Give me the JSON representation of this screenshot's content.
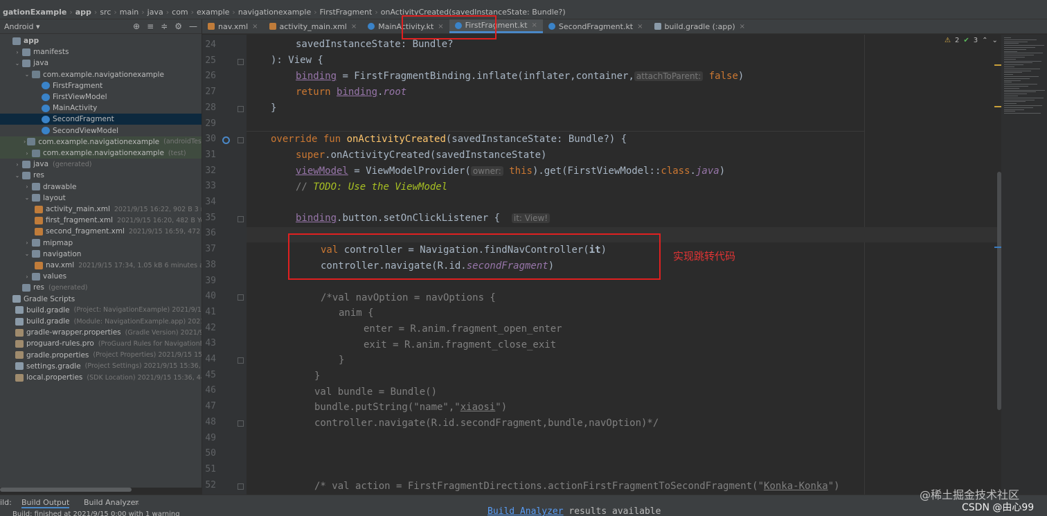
{
  "breadcrumb": [
    "gationExample",
    "app",
    "src",
    "main",
    "java",
    "com",
    "example",
    "navigationexample",
    "FirstFragment",
    "onActivityCreated(savedInstanceState: Bundle?)"
  ],
  "project": {
    "view": "Android",
    "tools": [
      "target-icon",
      "expand-icon",
      "collapse-icon",
      "gear-icon",
      "minimize-icon"
    ]
  },
  "tree": [
    {
      "depth": 0,
      "arrow": "",
      "icon": "folder",
      "label": "app",
      "meta": "",
      "bold": true
    },
    {
      "depth": 1,
      "arrow": "›",
      "icon": "folder",
      "label": "manifests",
      "meta": ""
    },
    {
      "depth": 1,
      "arrow": "⌄",
      "icon": "folder",
      "label": "java",
      "meta": ""
    },
    {
      "depth": 2,
      "arrow": "⌄",
      "icon": "pkg",
      "label": "com.example.navigationexample",
      "meta": ""
    },
    {
      "depth": 3,
      "arrow": "",
      "icon": "kt",
      "label": "FirstFragment",
      "meta": ""
    },
    {
      "depth": 3,
      "arrow": "",
      "icon": "kt",
      "label": "FirstViewModel",
      "meta": ""
    },
    {
      "depth": 3,
      "arrow": "",
      "icon": "kt",
      "label": "MainActivity",
      "meta": ""
    },
    {
      "depth": 3,
      "arrow": "",
      "icon": "kt",
      "label": "SecondFragment",
      "meta": "",
      "selected": true
    },
    {
      "depth": 3,
      "arrow": "",
      "icon": "kt",
      "label": "SecondViewModel",
      "meta": ""
    },
    {
      "depth": 2,
      "arrow": "›",
      "icon": "pkg",
      "label": "com.example.navigationexample",
      "meta": "(androidTest)",
      "test": true
    },
    {
      "depth": 2,
      "arrow": "›",
      "icon": "pkg",
      "label": "com.example.navigationexample",
      "meta": "(test)",
      "test": true
    },
    {
      "depth": 1,
      "arrow": "›",
      "icon": "folder",
      "label": "java",
      "meta": "(generated)"
    },
    {
      "depth": 1,
      "arrow": "⌄",
      "icon": "folder",
      "label": "res",
      "meta": ""
    },
    {
      "depth": 2,
      "arrow": "›",
      "icon": "folder",
      "label": "drawable",
      "meta": ""
    },
    {
      "depth": 2,
      "arrow": "⌄",
      "icon": "folder",
      "label": "layout",
      "meta": ""
    },
    {
      "depth": 3,
      "arrow": "",
      "icon": "xml",
      "label": "activity_main.xml",
      "meta": "2021/9/15 16:22, 902 B 3 minutes a"
    },
    {
      "depth": 3,
      "arrow": "",
      "icon": "xml",
      "label": "first_fragment.xml",
      "meta": "2021/9/15 16:20, 482 B Yesterday"
    },
    {
      "depth": 3,
      "arrow": "",
      "icon": "xml",
      "label": "second_fragment.xml",
      "meta": "2021/9/15 16:59, 472 B Yeste"
    },
    {
      "depth": 2,
      "arrow": "›",
      "icon": "folder",
      "label": "mipmap",
      "meta": ""
    },
    {
      "depth": 2,
      "arrow": "⌄",
      "icon": "folder",
      "label": "navigation",
      "meta": ""
    },
    {
      "depth": 3,
      "arrow": "",
      "icon": "xml",
      "label": "nav.xml",
      "meta": "2021/9/15 17:34, 1.05 kB 6 minutes ago"
    },
    {
      "depth": 2,
      "arrow": "›",
      "icon": "folder",
      "label": "values",
      "meta": ""
    },
    {
      "depth": 1,
      "arrow": "",
      "icon": "folder",
      "label": "res",
      "meta": "(generated)"
    },
    {
      "depth": 0,
      "arrow": "",
      "icon": "gradle",
      "label": "Gradle Scripts",
      "meta": ""
    },
    {
      "depth": 1,
      "arrow": "",
      "icon": "gradle",
      "label": "build.gradle",
      "meta": "(Project: NavigationExample)  2021/9/15 17"
    },
    {
      "depth": 1,
      "arrow": "",
      "icon": "gradle",
      "label": "build.gradle",
      "meta": "(Module: NavigationExample.app)  2021/9"
    },
    {
      "depth": 1,
      "arrow": "",
      "icon": "props",
      "label": "gradle-wrapper.properties",
      "meta": "(Gradle Version)  2021/9/15"
    },
    {
      "depth": 1,
      "arrow": "",
      "icon": "props",
      "label": "proguard-rules.pro",
      "meta": "(ProGuard Rules for NavigationExa"
    },
    {
      "depth": 1,
      "arrow": "",
      "icon": "props",
      "label": "gradle.properties",
      "meta": "(Project Properties)  2021/9/15 15:36,"
    },
    {
      "depth": 1,
      "arrow": "",
      "icon": "gradle",
      "label": "settings.gradle",
      "meta": "(Project Settings)  2021/9/15 15:36, 292 B"
    },
    {
      "depth": 1,
      "arrow": "",
      "icon": "props",
      "label": "local.properties",
      "meta": "(SDK Location)  2021/9/15 15:36, 446 B"
    }
  ],
  "tabs": [
    {
      "label": "nav.xml",
      "icon": "xml"
    },
    {
      "label": "activity_main.xml",
      "icon": "xml"
    },
    {
      "label": "MainActivity.kt",
      "icon": "kt"
    },
    {
      "label": "FirstFragment.kt",
      "icon": "kt",
      "active": true
    },
    {
      "label": "SecondFragment.kt",
      "icon": "kt"
    },
    {
      "label": "build.gradle (:app)",
      "icon": "gradle"
    }
  ],
  "inspections": {
    "warnings": "2",
    "ok": "3"
  },
  "line_numbers": [
    "24",
    "25",
    "26",
    "27",
    "28",
    "29",
    "30",
    "31",
    "32",
    "33",
    "34",
    "35",
    "36",
    "37",
    "38",
    "39",
    "40",
    "41",
    "42",
    "43",
    "44",
    "45",
    "46",
    "47",
    "48",
    "49",
    "50",
    "51",
    "52"
  ],
  "code": {
    "l24": "savedInstanceState: Bundle?",
    "l25": "): View {",
    "l26_a": "binding",
    "l26_b": " = FirstFragmentBinding.inflate(inflater,container,",
    "l26_hint": "attachToParent:",
    "l26_c": "false",
    "l26_d": ")",
    "l27_kw": "return ",
    "l27_a": "binding",
    "l27_b": ".",
    "l27_c": "root",
    "l28": "}",
    "l30_kw": "override fun ",
    "l30_fn": "onActivityCreated",
    "l30_rest": "(savedInstanceState: Bundle?) {",
    "l31_kw": "super",
    "l31_rest": ".onActivityCreated(savedInstanceState)",
    "l32_a": "viewModel",
    "l32_b": " = ViewModelProvider(",
    "l32_hint": "owner:",
    "l32_kw": "this",
    "l32_c": ").get(FirstViewModel::",
    "l32_kw2": "class",
    "l32_d": ".",
    "l32_e": "java",
    "l32_f": ")",
    "l33_c": "// ",
    "l33_todo": "TODO: Use the ViewModel",
    "l35_a": "binding",
    "l35_b": ".button.setOnClickListener {",
    "l35_hint": "it: View!",
    "l37_kw": "val ",
    "l37_rest": "controller = Navigation.findNavController(",
    "l37_it": "it",
    "l37_end": ")",
    "l38_a": "controller.navigate(R.id.",
    "l38_b": "secondFragment",
    "l38_c": ")",
    "l40": "/*val navOption = navOptions {",
    "l41": "anim {",
    "l42": "enter = R.anim.fragment_open_enter",
    "l43": "exit = R.anim.fragment_close_exit",
    "l44": "}",
    "l45": "}",
    "l46": "val bundle = Bundle()",
    "l47_a": "bundle.putString(\"name\",\"",
    "l47_b": "xiaosi",
    "l47_c": "\")",
    "l48": "controller.navigate(R.id.secondFragment,bundle,navOption)*/",
    "l52_a": "/* val action = FirstFragmentDirections.actionFirstFragmentToSecondFragment(\"",
    "l52_b": "Konka-Konka",
    "l52_c": "\")"
  },
  "annotation": "实现跳转代码",
  "bottom": {
    "prefix": "ild:",
    "tab1": "Build Output",
    "tab2": "Build Analyzer",
    "info": "Build: finished  at 2021/9/15 0:00 with 1 warning",
    "output_link": "Build Analyzer",
    "output_rest": " results available"
  },
  "watermark": "@稀土掘金技术社区",
  "watermark2": "CSDN @由心99"
}
